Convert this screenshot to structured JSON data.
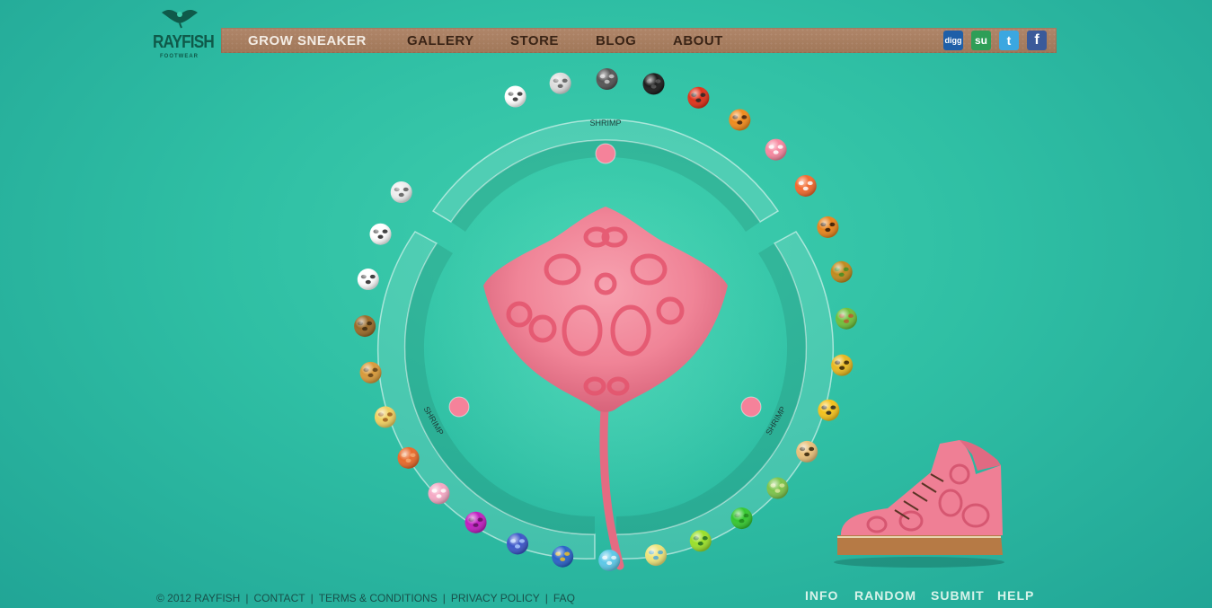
{
  "logo": {
    "word": "RAYFISH",
    "sub": "FOOTWEAR"
  },
  "nav": {
    "items": [
      {
        "label": "GROW SNEAKER",
        "active": true
      },
      {
        "label": "GALLERY",
        "active": false
      },
      {
        "label": "STORE",
        "active": false
      },
      {
        "label": "BLOG",
        "active": false
      },
      {
        "label": "ABOUT",
        "active": false
      }
    ],
    "social": [
      {
        "name": "digg-icon",
        "label": "digg",
        "color": "#1f5fa8"
      },
      {
        "name": "stumbleupon-icon",
        "label": "su",
        "color": "#2e9e57"
      },
      {
        "name": "twitter-icon",
        "label": "t",
        "color": "#3ba7e0"
      },
      {
        "name": "facebook-icon",
        "label": "f",
        "color": "#3b5a9a"
      }
    ]
  },
  "dial": {
    "top_label": "SHRIMP",
    "left_label": "SHRIMP",
    "right_label": "SHRIMP"
  },
  "patterns": [
    "zebra",
    "snake-grey",
    "marble-dark",
    "black-stripe",
    "red-spot",
    "tiger-orange",
    "pink-dots",
    "orange-stripe",
    "tiger-dark",
    "green-giraffe",
    "green-moss",
    "leopard-yellow",
    "wasp-stripe",
    "leopard",
    "green-scale",
    "green-glossy",
    "green-circuit",
    "yellow-stripe",
    "cyan-bubble",
    "blue-yellow-stripe",
    "blue-starry",
    "purple-glossy",
    "pink-floral",
    "orange-scale",
    "giraffe-yellow",
    "giraffe-brown",
    "brown-dots",
    "cow",
    "cow-large",
    "zebra-grey"
  ],
  "colors": {
    "background": "#2fbfa4",
    "ray": "#f07f94",
    "ray_spot": "#e84f6a",
    "nav_bar": "#a8805f"
  },
  "footer": {
    "links": [
      "© 2012 RAYFISH",
      "CONTACT",
      "TERMS & CONDITIONS",
      "PRIVACY POLICY",
      "FAQ"
    ],
    "actions": [
      "INFO",
      "RANDOM",
      "SUBMIT",
      "HELP"
    ]
  }
}
